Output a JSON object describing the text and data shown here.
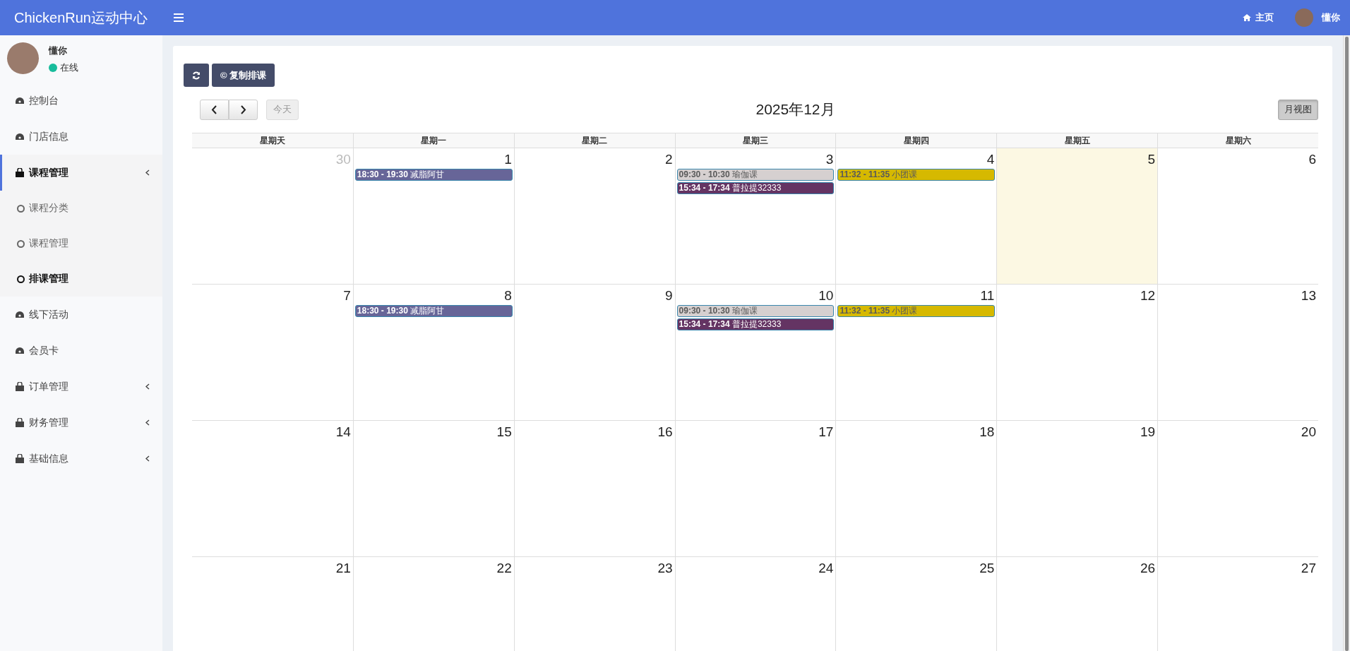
{
  "header": {
    "logo": "ChickenRun运动中心",
    "home_link": "主页",
    "user_name": "懂你"
  },
  "sidebar": {
    "user": {
      "name": "懂你",
      "status": "在线"
    },
    "items": [
      {
        "kind": "dashboard",
        "label": "控制台",
        "selected": false,
        "has_arrow": false
      },
      {
        "kind": "dashboard",
        "label": "门店信息",
        "selected": false,
        "has_arrow": false
      },
      {
        "kind": "bag",
        "label": "课程管理",
        "selected": true,
        "has_arrow": true,
        "children": [
          {
            "label": "课程分类",
            "selected": false
          },
          {
            "label": "课程管理",
            "selected": false
          },
          {
            "label": "排课管理",
            "selected": true
          }
        ]
      },
      {
        "kind": "dashboard",
        "label": "线下活动",
        "selected": false,
        "has_arrow": false
      },
      {
        "kind": "dashboard",
        "label": "会员卡",
        "selected": false,
        "has_arrow": false
      },
      {
        "kind": "bag",
        "label": "订单管理",
        "selected": false,
        "has_arrow": true
      },
      {
        "kind": "bag",
        "label": "财务管理",
        "selected": false,
        "has_arrow": true
      },
      {
        "kind": "bag",
        "label": "基础信息",
        "selected": false,
        "has_arrow": true
      }
    ]
  },
  "toolbar": {
    "copy_button": "© 复制排课"
  },
  "calendar": {
    "today_button": "今天",
    "title": "2025年12月",
    "view_button": "月视图",
    "weekdays": [
      "星期天",
      "星期一",
      "星期二",
      "星期三",
      "星期四",
      "星期五",
      "星期六"
    ],
    "weeks": [
      {
        "days": [
          {
            "number": "30",
            "other_month": true,
            "today": false
          },
          {
            "number": "1",
            "other_month": false,
            "today": false,
            "events": [
              {
                "text": "**18:30 - 19:30** 减脂阿甘",
                "color": "#676598"
              }
            ]
          },
          {
            "number": "2",
            "other_month": false,
            "today": false
          },
          {
            "number": "3",
            "other_month": false,
            "today": false,
            "events": [
              {
                "text": "**09:30 - 10:30** 瑜伽课",
                "color": "#d6d0d0"
              },
              {
                "text": "**15:34 - 17:34** 普拉提32333",
                "color": "#643463"
              }
            ]
          },
          {
            "number": "4",
            "other_month": false,
            "today": false,
            "events": [
              {
                "text": "**11:32 - 11:35** 小团课",
                "color": "#d6b900"
              }
            ]
          },
          {
            "number": "5",
            "other_month": false,
            "today": true
          },
          {
            "number": "6",
            "other_month": false,
            "today": false
          }
        ]
      },
      {
        "days": [
          {
            "number": "7",
            "other_month": false,
            "today": false
          },
          {
            "number": "8",
            "other_month": false,
            "today": false,
            "events": [
              {
                "text": "**18:30 - 19:30** 减脂阿甘",
                "color": "#676598"
              }
            ]
          },
          {
            "number": "9",
            "other_month": false,
            "today": false
          },
          {
            "number": "10",
            "other_month": false,
            "today": false,
            "events": [
              {
                "text": "**09:30 - 10:30** 瑜伽课",
                "color": "#d6d0d0"
              },
              {
                "text": "**15:34 - 17:34** 普拉提32333",
                "color": "#643463"
              }
            ]
          },
          {
            "number": "11",
            "other_month": false,
            "today": false,
            "events": [
              {
                "text": "**11:32 - 11:35** 小团课",
                "color": "#d6b900"
              }
            ]
          },
          {
            "number": "12",
            "other_month": false,
            "today": false
          },
          {
            "number": "13",
            "other_month": false,
            "today": false
          }
        ]
      },
      {
        "days": [
          {
            "number": "14",
            "other_month": false,
            "today": false
          },
          {
            "number": "15",
            "other_month": false,
            "today": false
          },
          {
            "number": "16",
            "other_month": false,
            "today": false
          },
          {
            "number": "17",
            "other_month": false,
            "today": false
          },
          {
            "number": "18",
            "other_month": false,
            "today": false
          },
          {
            "number": "19",
            "other_month": false,
            "today": false
          },
          {
            "number": "20",
            "other_month": false,
            "today": false
          }
        ]
      },
      {
        "days": [
          {
            "number": "21",
            "other_month": false,
            "today": false
          },
          {
            "number": "22",
            "other_month": false,
            "today": false
          },
          {
            "number": "23",
            "other_month": false,
            "today": false
          },
          {
            "number": "24",
            "other_month": false,
            "today": false
          },
          {
            "number": "25",
            "other_month": false,
            "today": false
          },
          {
            "number": "26",
            "other_month": false,
            "today": false
          },
          {
            "number": "27",
            "other_month": false,
            "today": false
          }
        ]
      }
    ]
  }
}
